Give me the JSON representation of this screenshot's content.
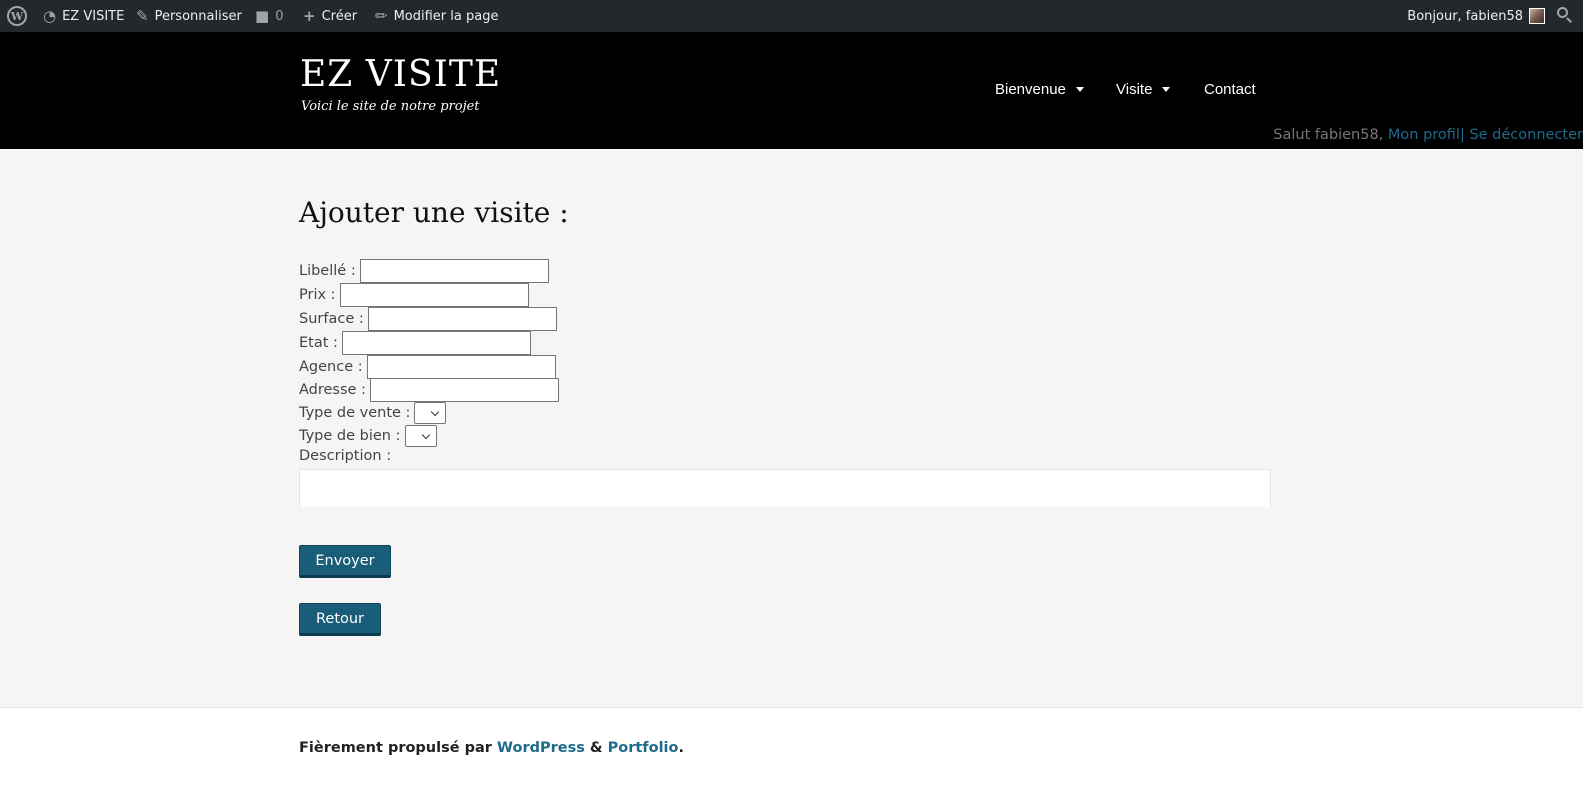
{
  "admin_bar": {
    "site_name": "EZ VISITE",
    "customize": "Personnaliser",
    "comments_count": "0",
    "create": "Créer",
    "edit_page": "Modifier la page",
    "greeting": "Bonjour, fabien58"
  },
  "header": {
    "site_title": "EZ VISITE",
    "tagline": "Voici le site de notre projet",
    "nav": [
      "Bienvenue",
      "Visite",
      "Contact"
    ],
    "user_hello": "Salut fabien58,",
    "profile_link": "Mon profil",
    "separator": "|",
    "logout_link": "Se déconnecter"
  },
  "form": {
    "title": "Ajouter une visite :",
    "labels": {
      "libelle": "Libellé :",
      "prix": "Prix :",
      "surface": "Surface :",
      "etat": "Etat :",
      "agence": "Agence :",
      "adresse": "Adresse :",
      "type_vente": "Type de vente :",
      "type_bien": "Type de bien :",
      "description": "Description :"
    },
    "submit": "Envoyer",
    "back": "Retour"
  },
  "footer": {
    "prefix": "Fièrement propulsé par",
    "wordpress": "WordPress",
    "amp": "&",
    "theme": "Portfolio",
    "dot": "."
  },
  "colors": {
    "admin_bar": "#23282d",
    "header": "#000000",
    "accent": "#1a5d79",
    "link": "#1e6b8c"
  },
  "icons": [
    "wordpress-icon",
    "dashboard-icon",
    "brush-icon",
    "comment-icon",
    "plus-icon",
    "pencil-icon",
    "search-icon"
  ]
}
